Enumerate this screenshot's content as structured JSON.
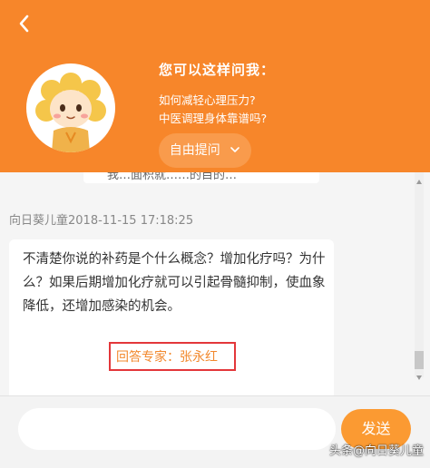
{
  "header": {
    "suggest_title": "您可以这样问我：",
    "questions": [
      "如何减轻心理压力?",
      "中医调理身体靠谱吗?"
    ],
    "free_ask_label": "自由提问",
    "accent_color": "#f7862a"
  },
  "chat": {
    "prev_partial_text": "我…面积就……的目的…",
    "sender": "向日葵儿童",
    "timestamp": "2018-11-15 17:18:25",
    "message": "不清楚你说的补药是个什么概念？增加化疗吗？为什么？如果后期增加化疗就可以引起骨髓抑制，使血象降低，还增加感染的机会。",
    "expert_label": "回答专家：张永红",
    "next_partial_text": "……"
  },
  "input": {
    "placeholder": "",
    "send_label": "发送"
  },
  "watermark": {
    "text": "头条@向日葵儿童"
  }
}
